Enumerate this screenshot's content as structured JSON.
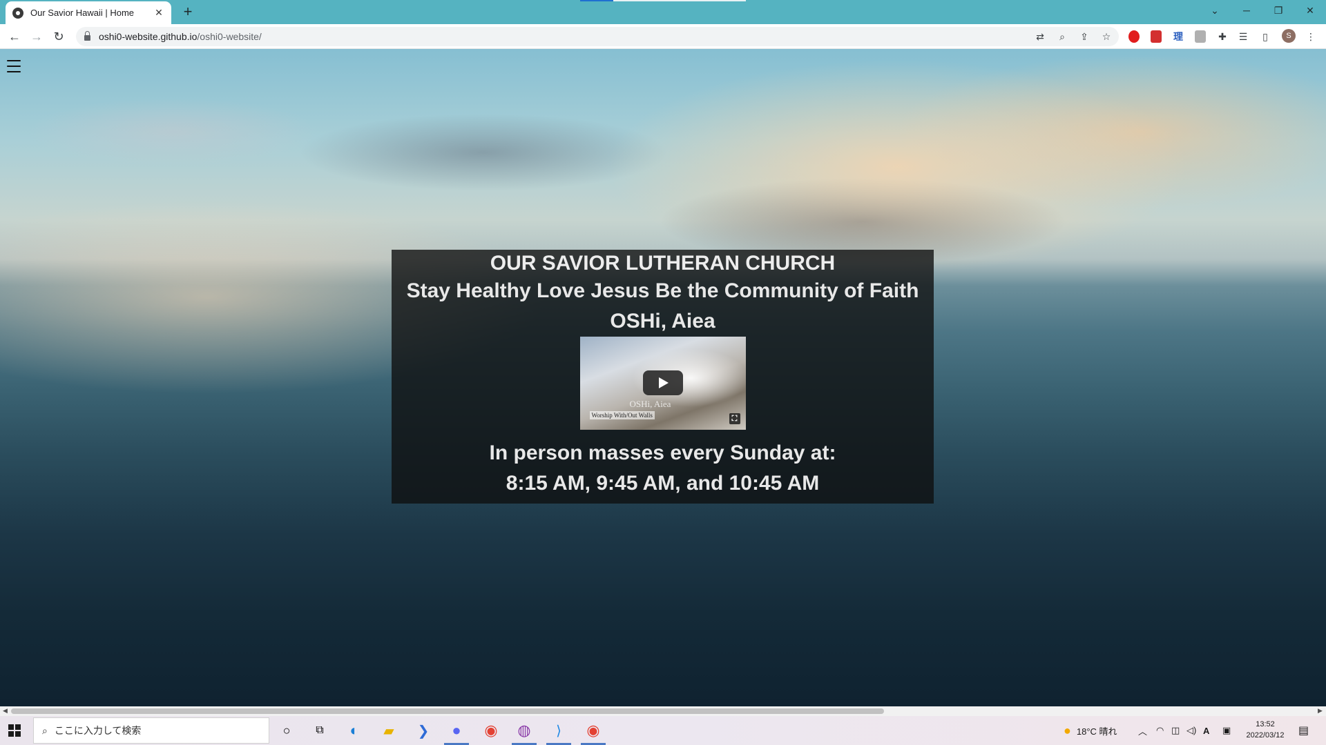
{
  "browser": {
    "tab_title": "Our Savior Hawaii | Home",
    "tab_close": "✕",
    "new_tab": "+",
    "url_host": "oshi0-website.github.io",
    "url_path": "/oshi0-website/",
    "profile_initial": "S",
    "window_controls": {
      "dropdown": "⌄",
      "minimize": "─",
      "restore": "❐",
      "close": "✕"
    },
    "toolbar_icons": [
      "translate-icon",
      "zoom-icon",
      "share-icon",
      "bookmark-star-icon",
      "extensions-icon",
      "reading-list-icon",
      "side-panel-icon",
      "menu-icon"
    ]
  },
  "page": {
    "heading": "OUR SAVIOR LUTHERAN CHURCH",
    "tagline": "Stay Healthy Love Jesus Be the Community of Faith",
    "location": "OSHi, Aiea",
    "video": {
      "overlay_title": "OSHi, Aiea",
      "overlay_subtitle": "Worship With/Out Walls"
    },
    "mass_line1": "In person masses every Sunday at:",
    "mass_line2": "8:15 AM, 9:45 AM, and 10:45 AM"
  },
  "taskbar": {
    "search_placeholder": "ここに入力して検索",
    "weather": "18°C 晴れ",
    "ime": "A",
    "time": "13:52",
    "date": "2022/03/12"
  },
  "colors": {
    "tabbar": "#55b3c1",
    "overlay_box": "rgba(14,14,14,0.78)",
    "taskbar_active": "#4a78c4"
  }
}
